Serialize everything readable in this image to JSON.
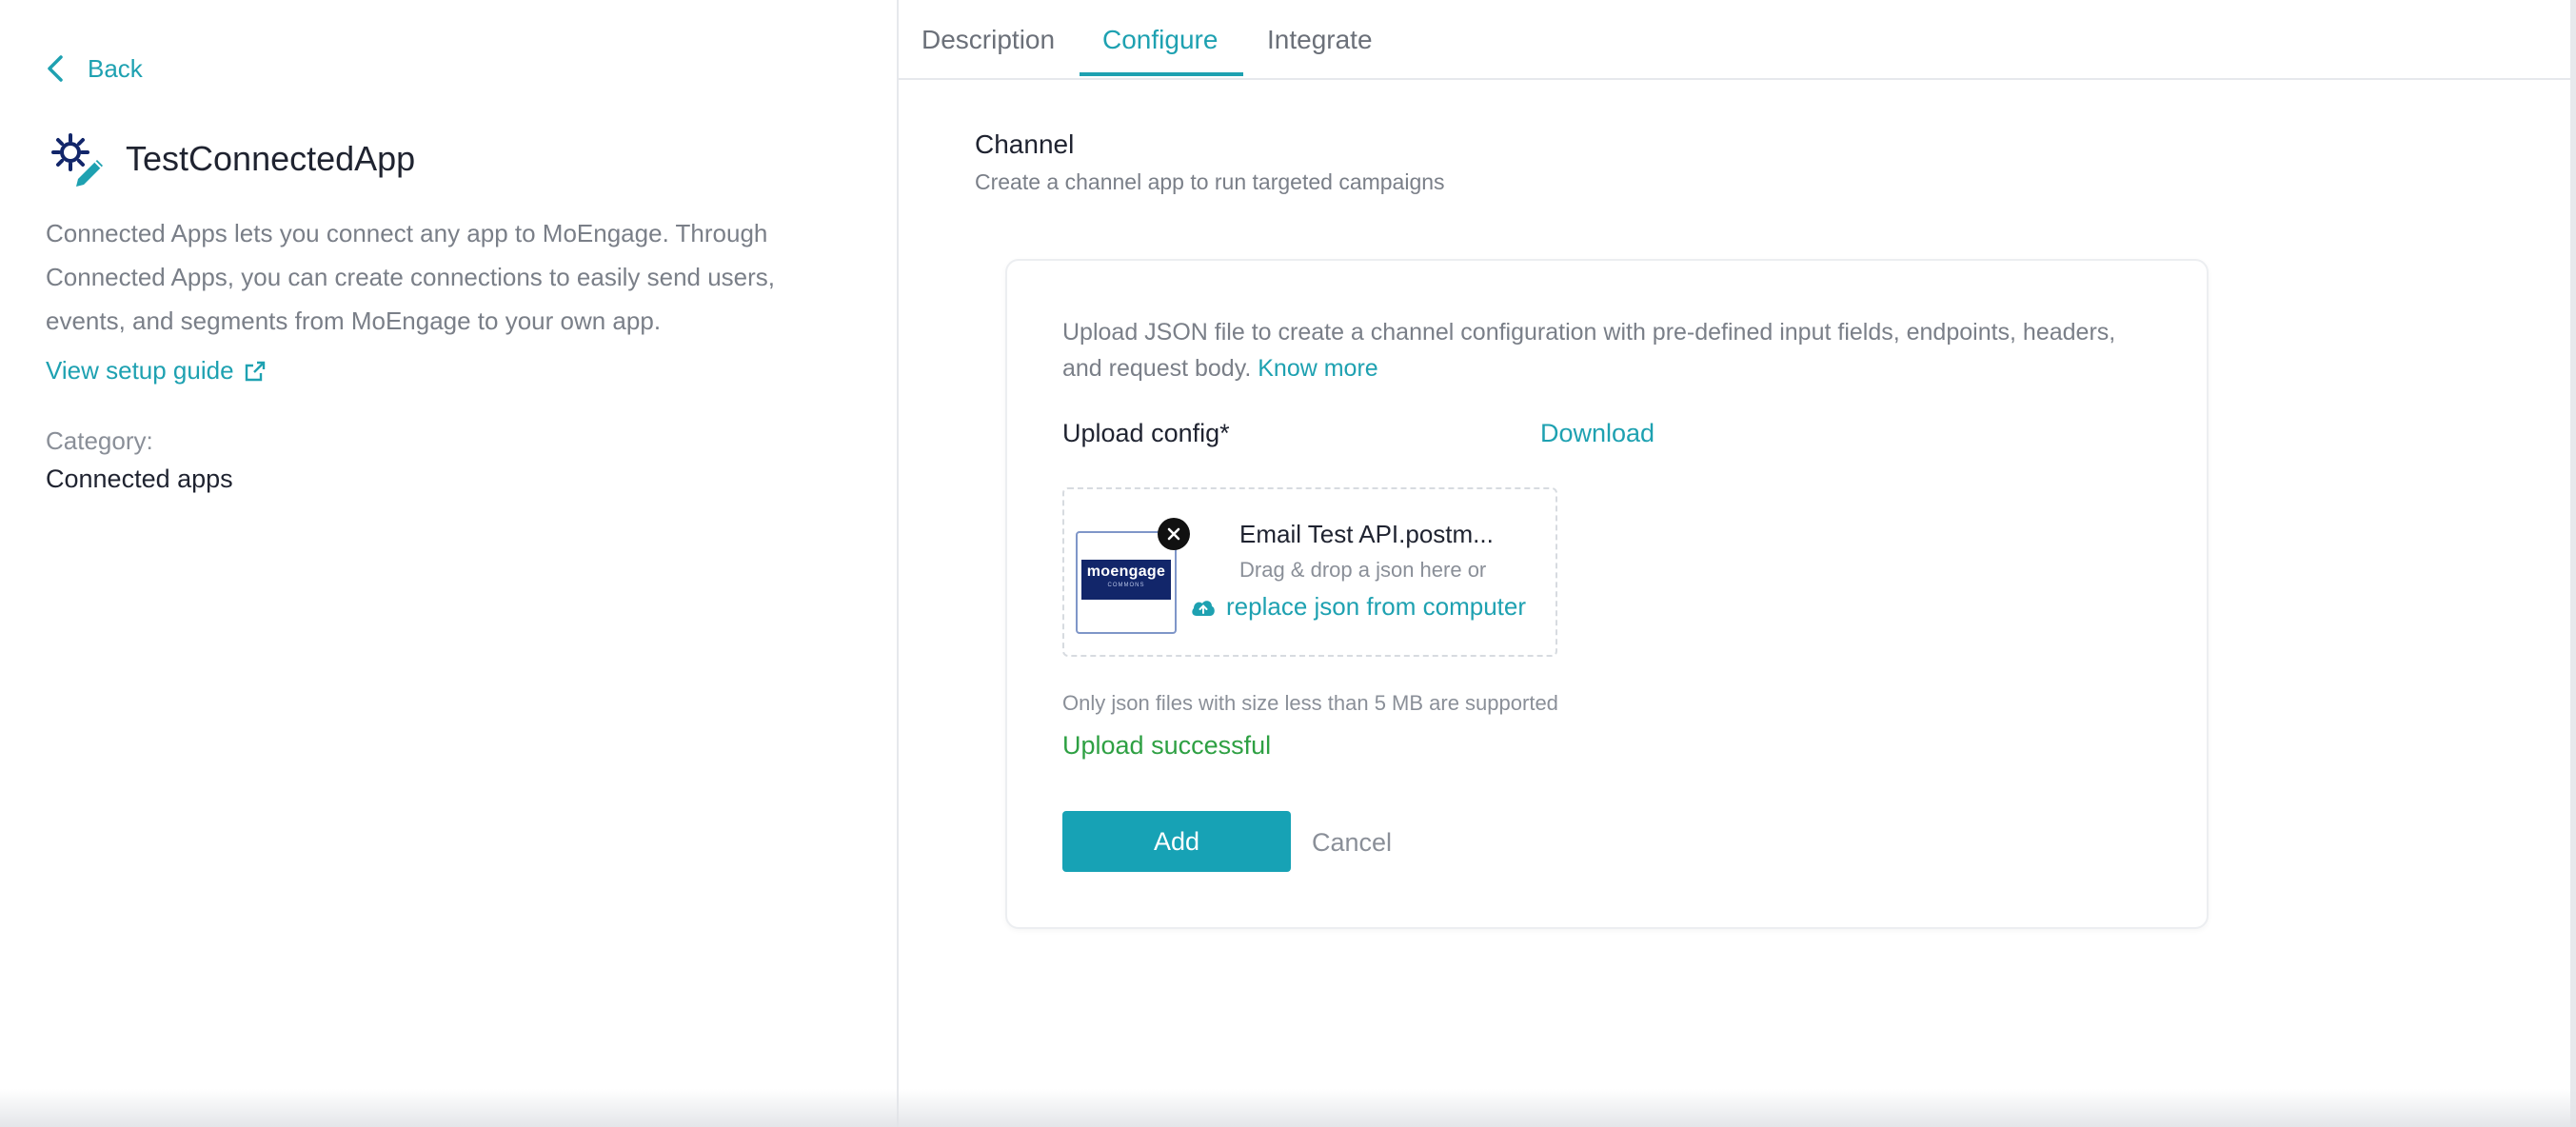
{
  "left": {
    "back_label": "Back",
    "app_title": "TestConnectedApp",
    "description": "Connected Apps lets you connect any app to MoEngage. Through Connected Apps, you can create connections to easily send users, events, and segments from MoEngage to your own app.",
    "setup_guide": "View setup guide",
    "category_label": "Category:",
    "category_value": "Connected apps"
  },
  "tabs": [
    {
      "label": "Description",
      "active": false
    },
    {
      "label": "Configure",
      "active": true
    },
    {
      "label": "Integrate",
      "active": false
    }
  ],
  "section": {
    "title": "Channel",
    "subtitle": "Create a channel app to run targeted campaigns"
  },
  "card": {
    "description": "Upload JSON file to create a channel configuration with pre-defined input fields, endpoints, headers, and request body.",
    "know_more": "Know more",
    "upload_label": "Upload config*",
    "download": "Download",
    "file_name": "Email Test API.postm...",
    "drag_text": "Drag & drop a json here or",
    "replace_text": "replace json from computer",
    "thumb_logo": "moengage",
    "thumb_sub": "COMMONS",
    "size_note": "Only json files with size less than 5 MB are supported",
    "status": "Upload successful",
    "add_button": "Add",
    "cancel_button": "Cancel"
  },
  "colors": {
    "accent": "#1ea1b1",
    "success": "#2ea043",
    "primary_button": "#17a2b5"
  },
  "icons": {
    "back": "chevron-left-icon",
    "app": "gear-pencil-icon",
    "external": "external-link-icon",
    "remove": "close-icon",
    "upload": "cloud-upload-icon"
  }
}
